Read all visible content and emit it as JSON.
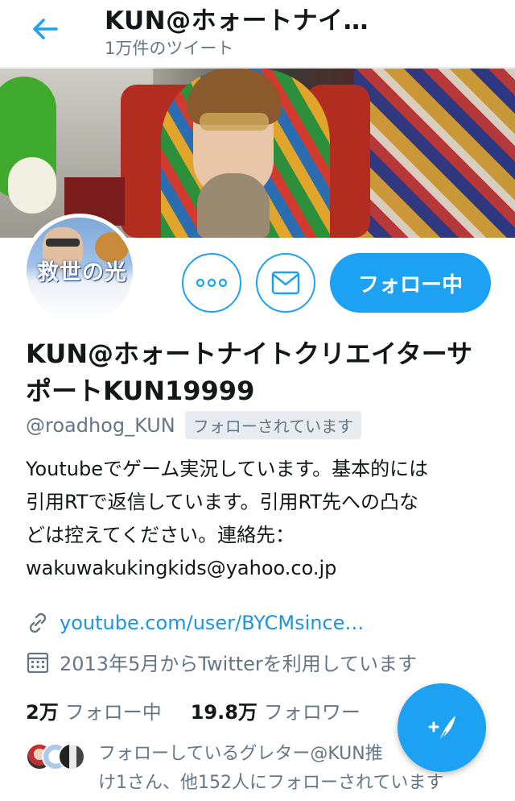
{
  "header": {
    "title": "KUN@ホォートナイ…",
    "tweet_count": "1万件のツイート"
  },
  "actions": {
    "follow_label": "フォロー中"
  },
  "profile": {
    "display_name": "KUN@ホォートナイトクリエイターサポートKUN19999",
    "handle": "@roadhog_KUN",
    "follows_you": "フォローされています",
    "bio_lines": [
      "Youtubeでゲーム実況しています。基本的には",
      "引用RTで返信しています。引用RT先への凸な",
      "どは控えてください。連絡先：",
      "wakuwakukingkids@yahoo.co.jp"
    ],
    "link": "youtube.com/user/BYCMsince…",
    "joined": "2013年5月からTwitterを利用しています"
  },
  "avatar_text": {
    "main": "救世の光"
  },
  "stats": {
    "following_count": "2万",
    "following_label": "フォロー中",
    "followers_count": "19.8万",
    "followers_label": "フォロワー"
  },
  "followers_you_know": {
    "line1": "フォローしているグレター@KUN推",
    "line2": "け1さん、他152人にフォローされています"
  },
  "colors": {
    "accent": "#1da1f2",
    "link": "#1b95e0",
    "muted": "#657786"
  }
}
